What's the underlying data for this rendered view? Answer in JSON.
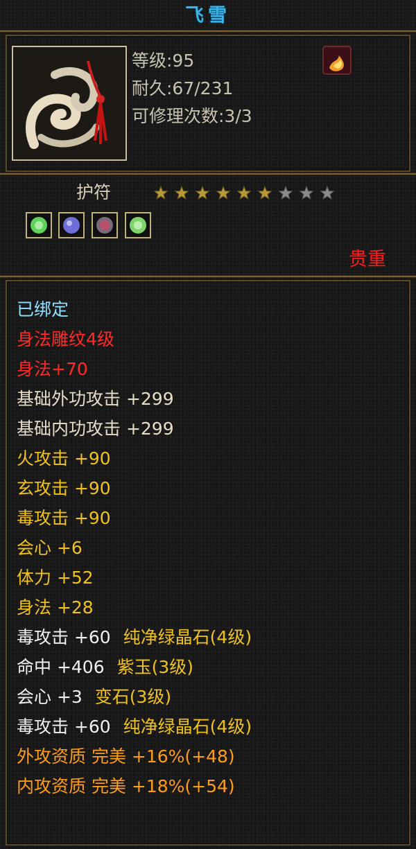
{
  "item": {
    "name": "飞雪",
    "level_text": "等级:95",
    "durability_text": "耐久:67/231",
    "repair_text": "可修理次数:3/3",
    "type": "护符",
    "stars_filled": 6,
    "stars_total": 9,
    "rarity": "贵重",
    "gems": [
      {
        "name": "green-gem-icon",
        "color": "#5fd25a"
      },
      {
        "name": "purple-gem-icon",
        "color": "#6e6ed8"
      },
      {
        "name": "red-gem-icon",
        "color": "#b8506b"
      },
      {
        "name": "green-gem-icon",
        "color": "#7ed46a"
      }
    ]
  },
  "attributes": {
    "bound": "已绑定",
    "engraving": "身法雕纹4级",
    "engraving_bonus": "身法+70",
    "base_outer": "基础外功攻击  +299",
    "base_inner": "基础内功攻击  +299",
    "fire": "火攻击  +90",
    "mystic": "玄攻击  +90",
    "poison": "毒攻击  +90",
    "crit": "会心  +6",
    "stamina": "体力  +52",
    "agility": "身法  +28",
    "gem1_stat": "毒攻击  +60",
    "gem1_name": "纯净绿晶石(4级)",
    "gem2_stat": "命中  +406",
    "gem2_name": "紫玉(3级)",
    "gem3_stat": "会心  +3",
    "gem3_name": "变石(3级)",
    "gem4_stat": "毒攻击  +60",
    "gem4_name": "纯净绿晶石(4级)",
    "quality_outer": "外攻资质   完美  +16%(+48)",
    "quality_inner": "内攻资质   完美  +18%(+54)"
  },
  "colors": {
    "title": "#39b4e6",
    "bound": "#8fe0ff",
    "engraving": "#ff2a2a",
    "base_stat": "#e6dcc8",
    "stat": "#f0c21a",
    "quality": "#ff9d17",
    "rarity": "#ff1c1c"
  }
}
